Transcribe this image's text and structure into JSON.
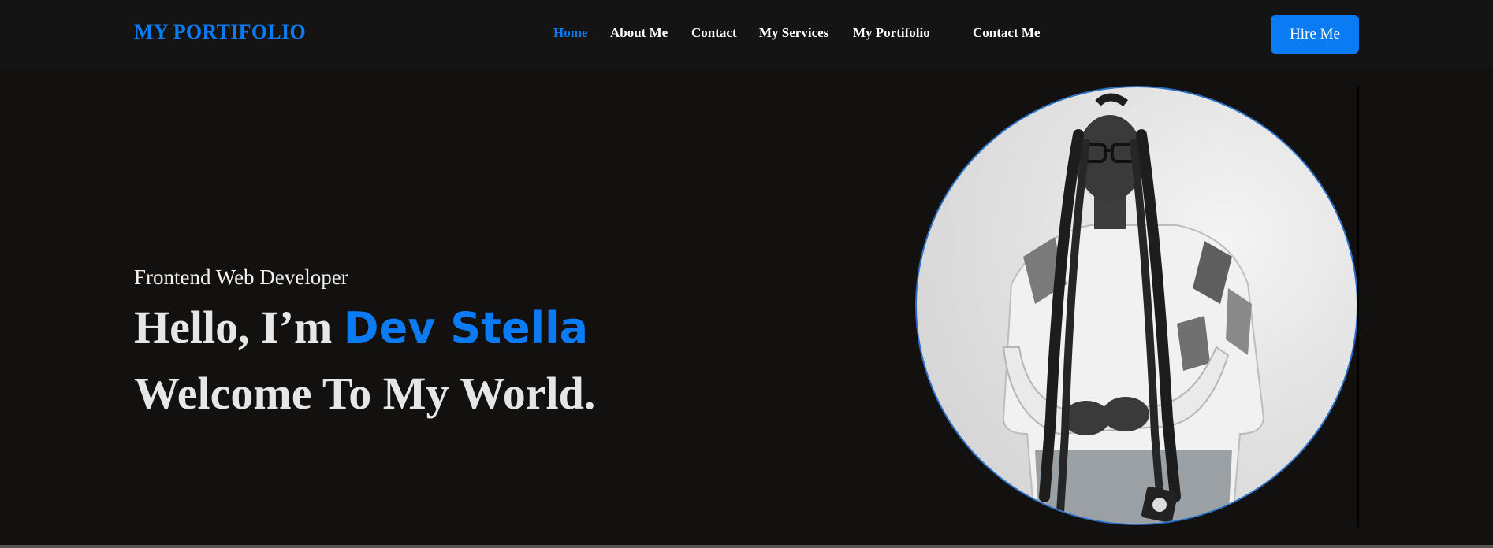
{
  "brand": {
    "logo": "MY PORTIFOLIO"
  },
  "nav": {
    "items": [
      {
        "label": "Home",
        "active": true
      },
      {
        "label": "About Me",
        "active": false
      },
      {
        "label": "Contact",
        "active": false
      },
      {
        "label": "My Services",
        "active": false
      },
      {
        "label": "My Portifolio",
        "active": false
      },
      {
        "label": "Contact Me",
        "active": false
      }
    ],
    "cta_label": "Hire Me"
  },
  "hero": {
    "subtitle": "Frontend Web Developer",
    "greeting": "Hello, I’m ",
    "name": "Dev Stella",
    "welcome": "Welcome To My World."
  },
  "colors": {
    "accent": "#0b7bf3",
    "background": "#12110f",
    "navbar": "#141414",
    "text": "#e6e6e6"
  }
}
